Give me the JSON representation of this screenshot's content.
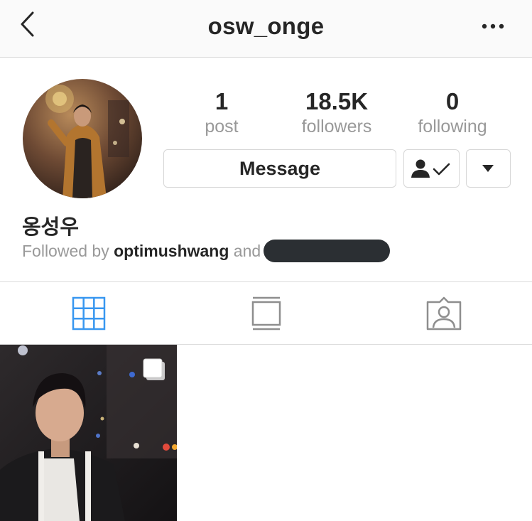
{
  "header": {
    "title": "osw_onge",
    "back_icon": "chevron-left-icon",
    "more_icon": "more-horizontal-icon"
  },
  "profile": {
    "stats": {
      "posts_count": "1",
      "posts_label": "post",
      "followers_count": "18.5K",
      "followers_label": "followers",
      "following_count": "0",
      "following_label": "following"
    },
    "actions": {
      "message_label": "Message",
      "following_icon": "person-check-icon",
      "dropdown_icon": "triangle-down-icon"
    },
    "display_name": "옹성우",
    "followed_by": {
      "prefix": "Followed by",
      "user": "optimushwang",
      "conjunction": "and"
    }
  },
  "tabs": [
    {
      "name": "grid",
      "icon": "grid-icon",
      "active": true
    },
    {
      "name": "list",
      "icon": "list-view-icon",
      "active": false
    },
    {
      "name": "tagged",
      "icon": "tagged-person-icon",
      "active": false
    }
  ],
  "posts": [
    {
      "type": "carousel",
      "icon": "multiple-photos-icon"
    }
  ],
  "colors": {
    "accent_blue": "#3897f0",
    "text_dark": "#262626",
    "text_muted": "#999999",
    "border": "#d6d6d6",
    "topbar_bg": "#fafafa"
  }
}
